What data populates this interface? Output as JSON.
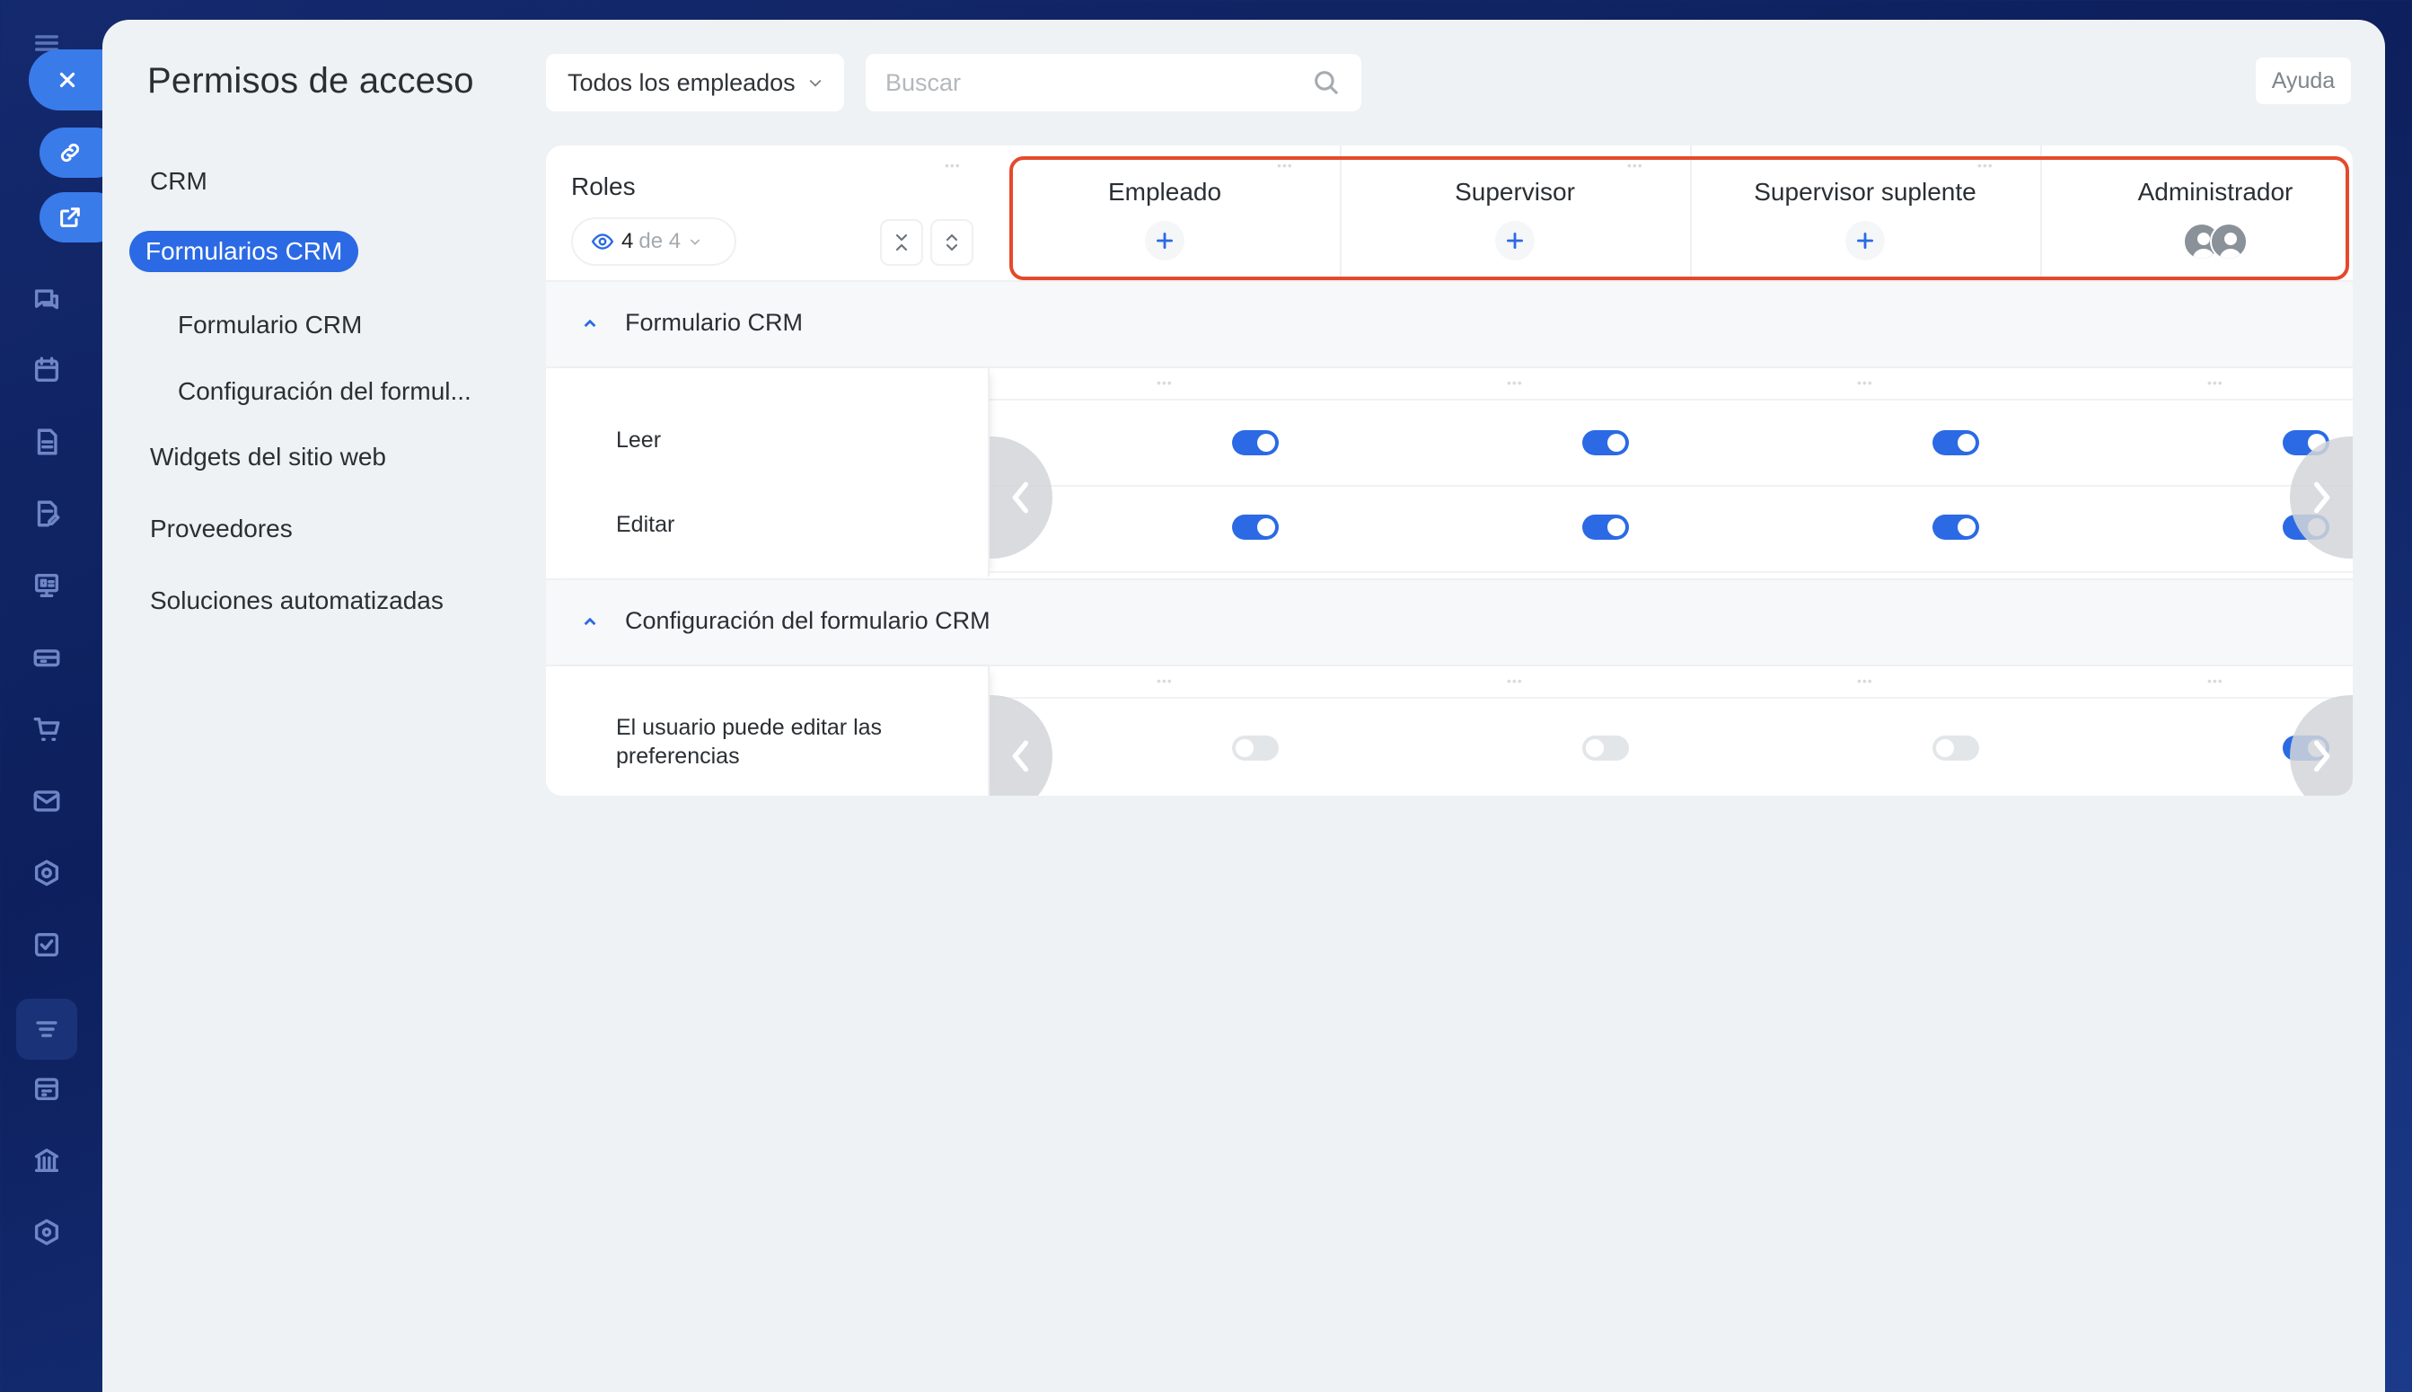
{
  "page": {
    "title": "Permisos de acceso",
    "help_label": "Ayuda"
  },
  "filter": {
    "employees_label": "Todos los empleados"
  },
  "search": {
    "placeholder": "Buscar"
  },
  "nav": {
    "items": [
      {
        "label": "CRM",
        "level": 0,
        "active": false
      },
      {
        "label": "Formularios CRM",
        "level": 0,
        "active": true
      },
      {
        "label": "Formulario CRM",
        "level": 1,
        "active": false
      },
      {
        "label": "Configuración del formul...",
        "level": 1,
        "active": false
      },
      {
        "label": "Widgets del sitio web",
        "level": 0,
        "active": false
      },
      {
        "label": "Proveedores",
        "level": 0,
        "active": false
      },
      {
        "label": "Soluciones automatizadas",
        "level": 0,
        "active": false
      }
    ]
  },
  "table": {
    "roles_label": "Roles",
    "visible_count": "4",
    "of_total": "de 4",
    "roles": [
      "Empleado",
      "Supervisor",
      "Supervisor suplente",
      "Administrador"
    ],
    "sections": [
      {
        "title": "Formulario CRM",
        "rows": [
          {
            "label": "Leer",
            "values": [
              true,
              true,
              true,
              true
            ]
          },
          {
            "label": "Editar",
            "values": [
              true,
              true,
              true,
              true
            ]
          }
        ]
      },
      {
        "title": "Configuración del formulario CRM",
        "rows": [
          {
            "label": "El usuario puede editar las preferencias",
            "values": [
              false,
              false,
              false,
              true
            ]
          }
        ]
      }
    ]
  },
  "colors": {
    "accent": "#2b6ae4",
    "highlight_border": "#e5492b",
    "background": "#0d1f5c"
  },
  "icons": [
    "menu-icon",
    "close-icon",
    "link-icon",
    "open-external-icon",
    "chat-icon",
    "calendar-icon",
    "document-icon",
    "edit-document-icon",
    "presentation-icon",
    "inbox-icon",
    "cart-icon",
    "mail-icon",
    "hexagon-icon",
    "checkbox-icon",
    "filter-icon",
    "schedule-icon",
    "bank-icon",
    "settings-icon",
    "search-icon",
    "eye-icon",
    "collapse-all-icon",
    "expand-all-icon",
    "add-icon",
    "user-group-icon",
    "chevron-up-icon",
    "arrow-left-icon",
    "arrow-right-icon"
  ]
}
